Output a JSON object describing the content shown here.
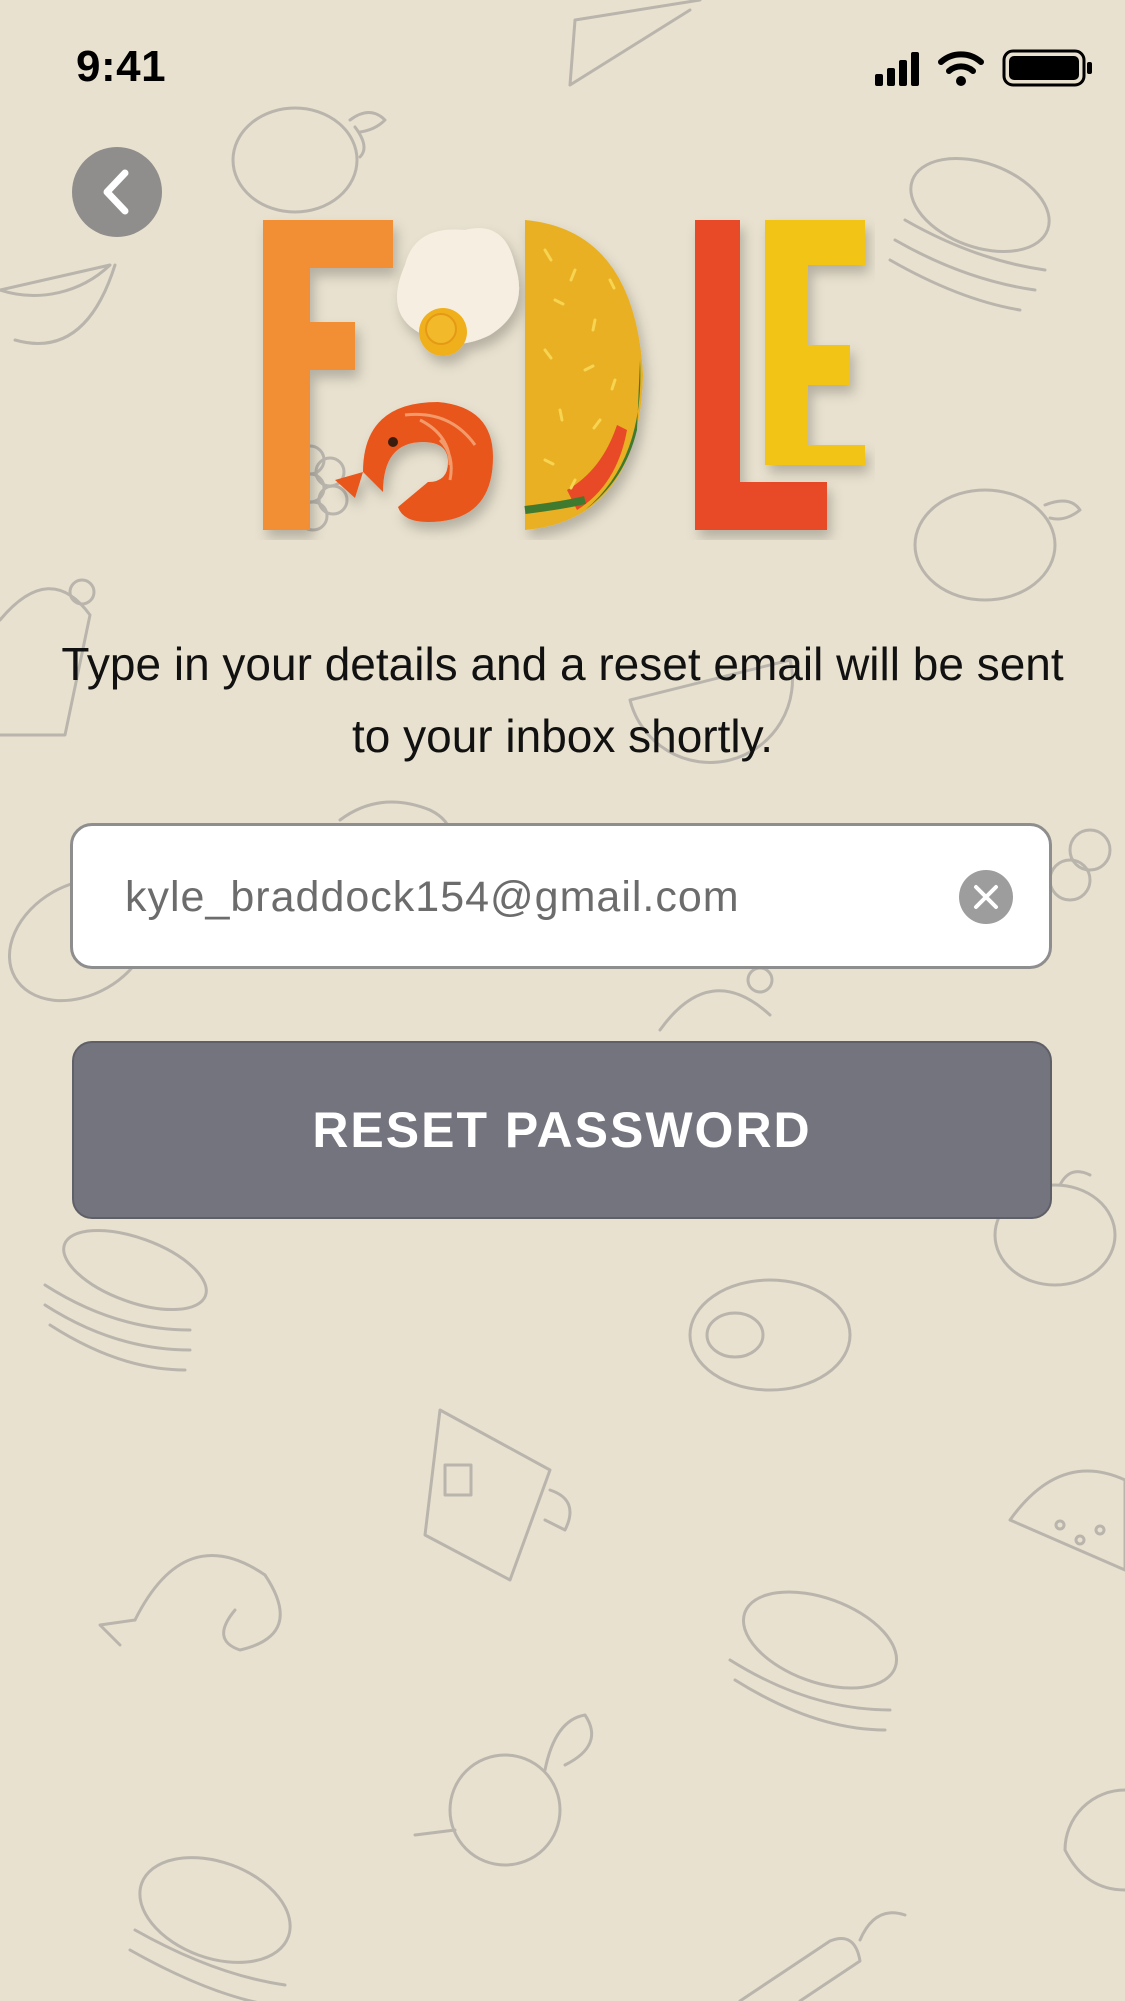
{
  "status_bar": {
    "time": "9:41",
    "icons": [
      "signal-icon",
      "wifi-icon",
      "battery-icon"
    ]
  },
  "nav": {
    "back_icon": "chevron-left-icon"
  },
  "logo": {
    "text": "FOODLE",
    "letter_colors": [
      "#f28f35",
      "#e8b024",
      "#e84a25",
      "#f1c418"
    ]
  },
  "reset": {
    "description": "Type in your details and a reset email will be sent to your inbox shortly.",
    "email_value": "kyle_braddock154@gmail.com",
    "clear_icon": "close-icon",
    "button_label": "RESET PASSWORD"
  },
  "colors": {
    "background": "#e8e1cf",
    "button": "#74747e",
    "back_button": "#8f8e8c"
  }
}
